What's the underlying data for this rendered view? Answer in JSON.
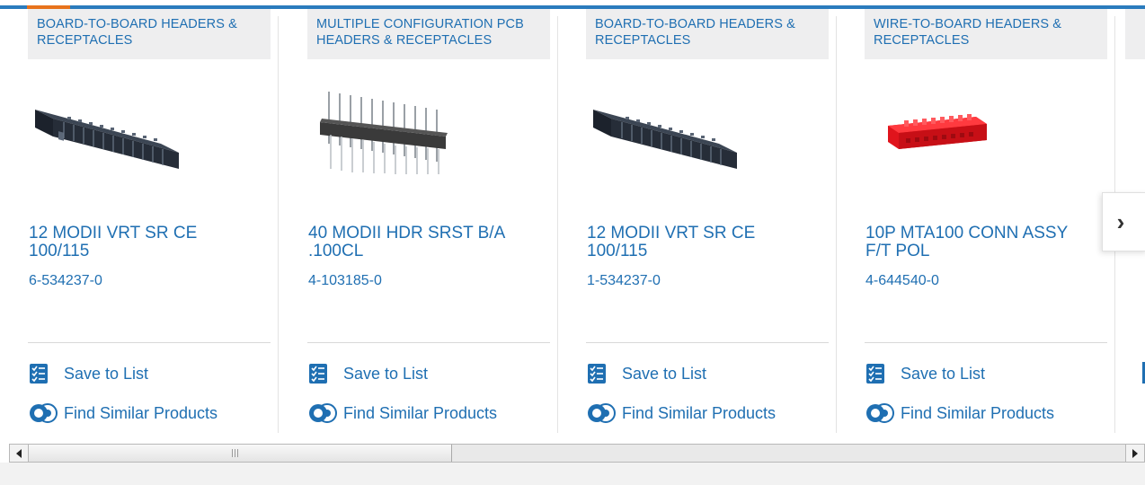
{
  "products": [
    {
      "category": "BOARD-TO-BOARD HEADERS & RECEPTACLES",
      "name": "12 MODII VRT SR CE 100/115",
      "part_number": "6-534237-0",
      "image_icon": "black-receptacle-connector",
      "save_label": "Save to List",
      "similar_label": "Find Similar Products"
    },
    {
      "category": "MULTIPLE CONFIGURATION PCB HEADERS & RECEPTACLES",
      "name": "40 MODII HDR SRST B/A .100CL",
      "part_number": "4-103185-0",
      "image_icon": "pin-header-connector",
      "save_label": "Save to List",
      "similar_label": "Find Similar Products"
    },
    {
      "category": "BOARD-TO-BOARD HEADERS & RECEPTACLES",
      "name": "12 MODII VRT SR CE 100/115",
      "part_number": "1-534237-0",
      "image_icon": "black-receptacle-connector",
      "save_label": "Save to List",
      "similar_label": "Find Similar Products"
    },
    {
      "category": "WIRE-TO-BOARD HEADERS & RECEPTACLES",
      "name": "10P MTA100 CONN ASSY F/T POL",
      "part_number": "4-644540-0",
      "image_icon": "red-mta-connector",
      "save_label": "Save to List",
      "similar_label": "Find Similar Products"
    }
  ],
  "carousel": {
    "next_icon": "chevron-right-icon",
    "next_glyph": "›"
  },
  "colors": {
    "link": "#1f6fb2",
    "accent_bar": "#2a7bbd",
    "active_tab": "#e8731c",
    "category_bg": "#eeeeef"
  }
}
